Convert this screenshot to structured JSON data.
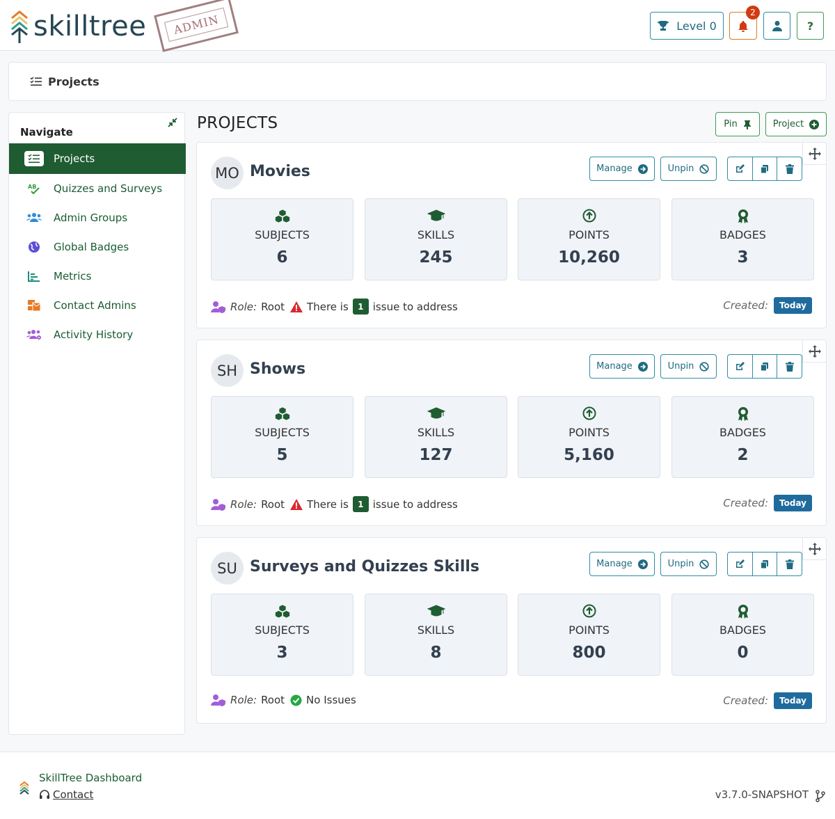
{
  "header": {
    "logo_text": "skilltree",
    "stamp_text": "ADMIN",
    "level_label": "Level 0",
    "notification_count": "2",
    "help_label": "?"
  },
  "breadcrumb": {
    "label": "Projects"
  },
  "sidebar": {
    "title": "Navigate",
    "items": [
      {
        "label": "Projects",
        "icon": "checklist-icon",
        "color": "#1f5c32"
      },
      {
        "label": "Quizzes and Surveys",
        "icon": "spellcheck-icon",
        "color": "#2e9e3c"
      },
      {
        "label": "Admin Groups",
        "icon": "users-icon",
        "color": "#2f8cd8"
      },
      {
        "label": "Global Badges",
        "icon": "globe-icon",
        "color": "#5b4fd8"
      },
      {
        "label": "Metrics",
        "icon": "chart-icon",
        "color": "#1a8c7a"
      },
      {
        "label": "Contact Admins",
        "icon": "mail-bulk-icon",
        "color": "#e87a25"
      },
      {
        "label": "Activity History",
        "icon": "users-cog-icon",
        "color": "#a25dd8"
      }
    ]
  },
  "main": {
    "title": "PROJECTS",
    "pin_label": "Pin",
    "new_project_label": "Project",
    "manage_label": "Manage",
    "unpin_label": "Unpin",
    "role_label": "Role:",
    "created_label": "Created:",
    "stat_labels": [
      "SUBJECTS",
      "SKILLS",
      "POINTS",
      "BADGES"
    ],
    "projects": [
      {
        "initials": "MO",
        "name": "Movies",
        "subjects": "6",
        "skills": "245",
        "points": "10,260",
        "badges": "3",
        "role": "Root",
        "issue_prefix": "There is",
        "issue_count": "1",
        "issue_suffix": "issue to address",
        "created": "Today"
      },
      {
        "initials": "SH",
        "name": "Shows",
        "subjects": "5",
        "skills": "127",
        "points": "5,160",
        "badges": "2",
        "role": "Root",
        "issue_prefix": "There is",
        "issue_count": "1",
        "issue_suffix": "issue to address",
        "created": "Today"
      },
      {
        "initials": "SU",
        "name": "Surveys and Quizzes Skills",
        "subjects": "3",
        "skills": "8",
        "points": "800",
        "badges": "0",
        "role": "Root",
        "no_issues_label": "No Issues",
        "created": "Today"
      }
    ]
  },
  "footer": {
    "name": "SkillTree Dashboard",
    "contact": "Contact",
    "version": "v3.7.0-SNAPSHOT"
  }
}
